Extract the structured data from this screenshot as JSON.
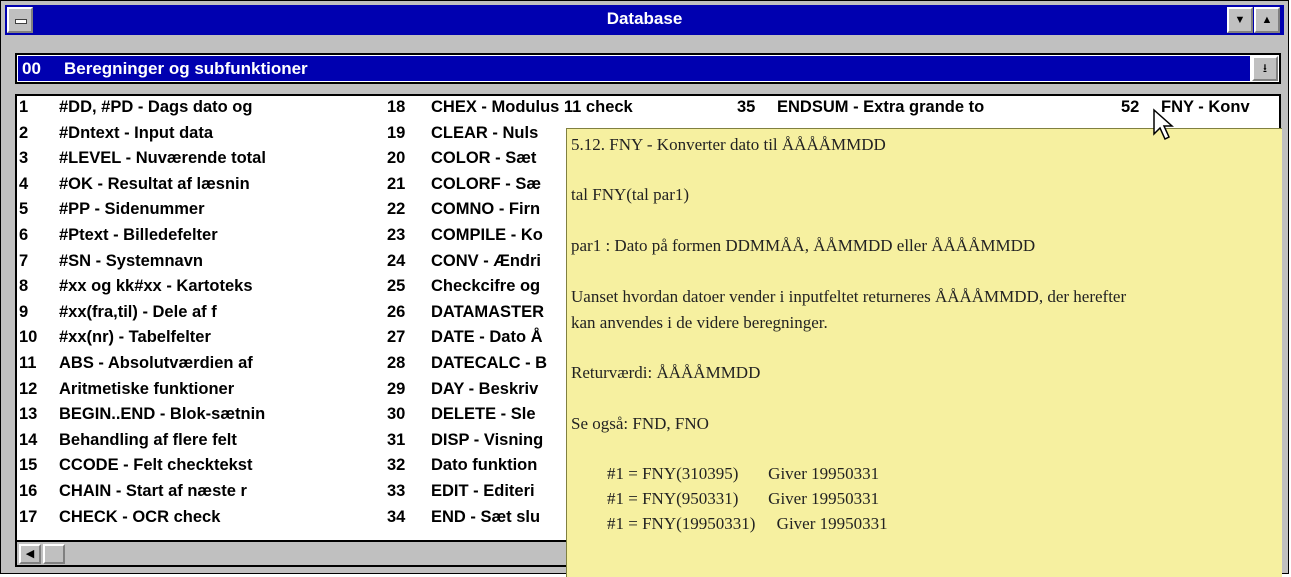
{
  "window": {
    "title": "Database"
  },
  "combo": {
    "number": "00",
    "label": "Beregninger og subfunktioner"
  },
  "list": {
    "columns": [
      [
        {
          "n": "1",
          "t": "#DD, #PD - Dags dato og"
        },
        {
          "n": "2",
          "t": "#Dntext - Input data"
        },
        {
          "n": "3",
          "t": "#LEVEL - Nuværende total"
        },
        {
          "n": "4",
          "t": "#OK - Resultat af læsnin"
        },
        {
          "n": "5",
          "t": "#PP - Sidenummer"
        },
        {
          "n": "6",
          "t": "#Ptext - Billedefelter"
        },
        {
          "n": "7",
          "t": "#SN - Systemnavn"
        },
        {
          "n": "8",
          "t": "#xx og kk#xx - Kartoteks"
        },
        {
          "n": "9",
          "t": "#xx(fra,til) - Dele af f"
        },
        {
          "n": "10",
          "t": "#xx(nr) - Tabelfelter"
        },
        {
          "n": "11",
          "t": "ABS - Absolutværdien af"
        },
        {
          "n": "12",
          "t": "Aritmetiske funktioner"
        },
        {
          "n": "13",
          "t": "BEGIN..END - Blok-sætnin"
        },
        {
          "n": "14",
          "t": "Behandling af flere felt"
        },
        {
          "n": "15",
          "t": "CCODE - Felt checktekst"
        },
        {
          "n": "16",
          "t": "CHAIN - Start af næste r"
        },
        {
          "n": "17",
          "t": "CHECK - OCR check"
        }
      ],
      [
        {
          "n": "18",
          "t": "CHEX - Modulus 11 check"
        },
        {
          "n": "19",
          "t": "CLEAR - Nuls"
        },
        {
          "n": "20",
          "t": "COLOR - Sæt"
        },
        {
          "n": "21",
          "t": "COLORF - Sæ"
        },
        {
          "n": "22",
          "t": "COMNO - Firn"
        },
        {
          "n": "23",
          "t": "COMPILE - Ko"
        },
        {
          "n": "24",
          "t": "CONV - Ændri"
        },
        {
          "n": "25",
          "t": "Checkcifre og"
        },
        {
          "n": "26",
          "t": "DATAMASTER"
        },
        {
          "n": "27",
          "t": "DATE - Dato Å"
        },
        {
          "n": "28",
          "t": "DATECALC - B"
        },
        {
          "n": "29",
          "t": "DAY - Beskriv"
        },
        {
          "n": "30",
          "t": "DELETE - Sle"
        },
        {
          "n": "31",
          "t": "DISP - Visning"
        },
        {
          "n": "32",
          "t": "Dato funktion"
        },
        {
          "n": "33",
          "t": "EDIT - Editeri"
        },
        {
          "n": "34",
          "t": "END - Sæt slu"
        }
      ],
      [
        {
          "n": "35",
          "t": "ENDSUM - Extra grande to"
        }
      ],
      [
        {
          "n": "52",
          "t": "FNY - Konv"
        }
      ]
    ]
  },
  "tooltip": {
    "heading": "5.12. FNY - Konverter dato til ÅÅÅÅMMDD",
    "syntax": "tal FNY(tal par1)",
    "param": "par1 : Dato på formen DDMMÅÅ, ÅÅMMDD eller ÅÅÅÅMMDD",
    "desc_line1": "Uanset hvordan datoer vender i inputfeltet returneres ÅÅÅÅMMDD, der herefter",
    "desc_line2": "kan anvendes i de videre beregninger.",
    "return_value": "Returværdi: ÅÅÅÅMMDD",
    "see_also": "Se også: FND, FNO",
    "examples": [
      "#1 = FNY(310395)       Giver 19950331",
      "#1 = FNY(950331)       Giver 19950331",
      "#1 = FNY(19950331)     Giver 19950331"
    ]
  },
  "colors": {
    "titlebar": "#0000b0",
    "tooltip_bg": "#f6f0a0",
    "window_bg": "#c0c0c0"
  },
  "icons": {
    "system_menu": "system-menu-icon",
    "minimize": "minimize-arrow-icon",
    "maximize": "maximize-arrow-icon",
    "dropdown": "dropdown-arrow-icon",
    "scroll_left": "left-arrow-icon",
    "cursor": "mouse-pointer-icon"
  }
}
